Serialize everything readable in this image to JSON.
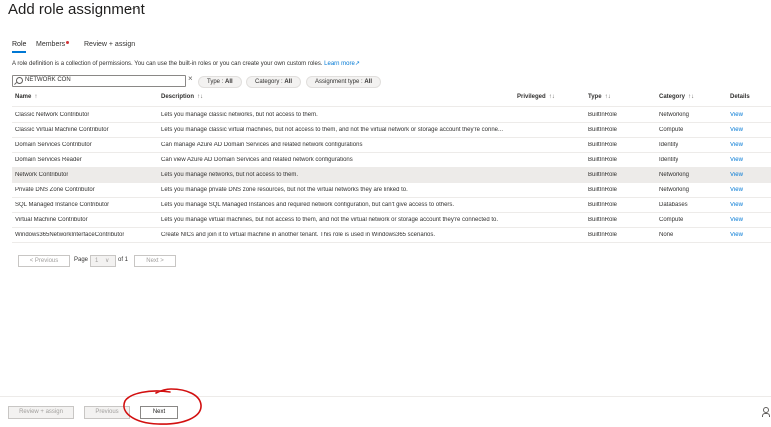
{
  "header": {
    "title": "Add role assignment",
    "more": "···"
  },
  "tabs": [
    {
      "label": "Role",
      "active": true
    },
    {
      "label": "Members",
      "required_dot": true
    },
    {
      "label": "Review + assign"
    }
  ],
  "description": {
    "text": "A role definition is a collection of permissions. You can use the built-in roles or you can create your own custom roles.",
    "learn_more": "Learn more"
  },
  "search": {
    "value": "NETWORK CON",
    "clear_icon": "close-icon"
  },
  "filters": [
    {
      "label": "Type : ",
      "value": "All"
    },
    {
      "label": "Category : ",
      "value": "All"
    },
    {
      "label": "Assignment type : ",
      "value": "All"
    }
  ],
  "table": {
    "columns": {
      "name": "Name",
      "description": "Description",
      "privileged": "Privileged",
      "type": "Type",
      "category": "Category",
      "details": "Details"
    },
    "sort_glyph": "↑↓",
    "name_sort_glyph": "↑",
    "rows": [
      {
        "name": "Classic Network Contributor",
        "description": "Lets you manage classic networks, but not access to them.",
        "type": "BuiltInRole",
        "category": "Networking",
        "details": "View"
      },
      {
        "name": "Classic Virtual Machine Contributor",
        "description": "Lets you manage classic virtual machines, but not access to them, and not the virtual network or storage account they're conne...",
        "type": "BuiltInRole",
        "category": "Compute",
        "details": "View"
      },
      {
        "name": "Domain Services Contributor",
        "description": "Can manage Azure AD Domain Services and related network configurations",
        "type": "BuiltInRole",
        "category": "Identity",
        "details": "View"
      },
      {
        "name": "Domain Services Reader",
        "description": "Can view Azure AD Domain Services and related network configurations",
        "type": "BuiltInRole",
        "category": "Identity",
        "details": "View"
      },
      {
        "name": "Network Contributor",
        "description": "Lets you manage networks, but not access to them.",
        "type": "BuiltInRole",
        "category": "Networking",
        "details": "View",
        "selected": true
      },
      {
        "name": "Private DNS Zone Contributor",
        "description": "Lets you manage private DNS zone resources, but not the virtual networks they are linked to.",
        "type": "BuiltInRole",
        "category": "Networking",
        "details": "View"
      },
      {
        "name": "SQL Managed Instance Contributor",
        "description": "Lets you manage SQL Managed Instances and required network configuration, but can't give access to others.",
        "type": "BuiltInRole",
        "category": "Databases",
        "details": "View"
      },
      {
        "name": "Virtual Machine Contributor",
        "description": "Lets you manage virtual machines, but not access to them, and not the virtual network or storage account they're connected to.",
        "type": "BuiltInRole",
        "category": "Compute",
        "details": "View"
      },
      {
        "name": "Windows365NetworkInterfaceContributor",
        "description": "Create NICs and join it to virtual machine in another tenant. This role is used in Windows365 scenarios.",
        "type": "BuiltInRole",
        "category": "None",
        "details": "View"
      }
    ]
  },
  "pager": {
    "previous": "< Previous",
    "page_label": "Page",
    "page_value": "1",
    "of_label": "of 1",
    "next": "Next >"
  },
  "footer": {
    "review_assign": "Review + assign",
    "previous": "Previous",
    "next": "Next"
  },
  "colors": {
    "accent": "#0078d4",
    "annotation": "#d20f0f",
    "selected_row": "#edebe9",
    "required_dot": "#d13438"
  },
  "icons": {
    "search": "search-icon",
    "learn_more": "external-link-icon",
    "feedback": "person-icon"
  }
}
